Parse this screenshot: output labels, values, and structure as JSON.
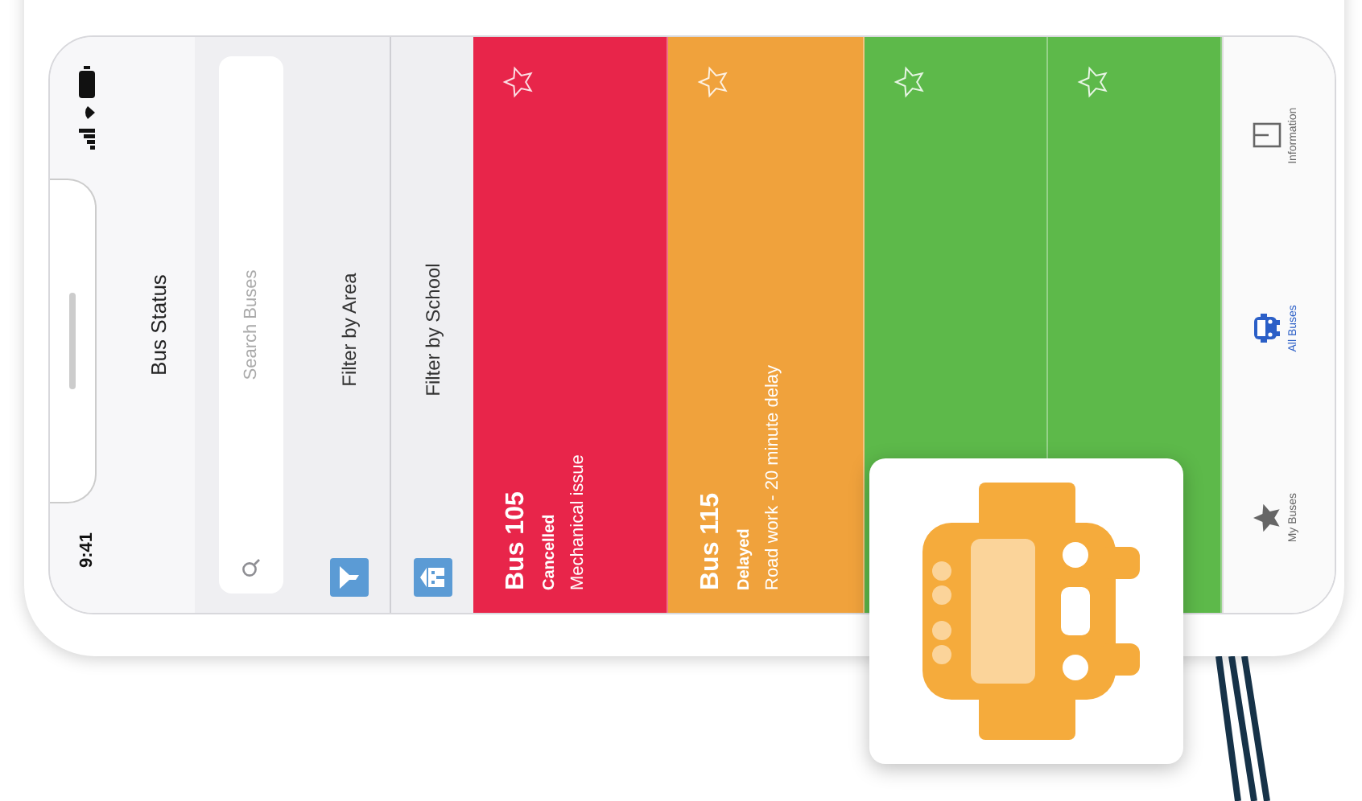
{
  "status_bar": {
    "time": "9:41"
  },
  "nav": {
    "title": "Bus Status"
  },
  "search": {
    "placeholder": "Search Buses"
  },
  "filters": [
    {
      "kind": "area",
      "label": "Filter by Area"
    },
    {
      "kind": "school",
      "label": "Filter by School"
    }
  ],
  "buses": [
    {
      "name": "Bus 105",
      "status": "Cancelled",
      "detail": "Mechanical issue",
      "color": "#e8254a",
      "favorite": false
    },
    {
      "name": "Bus 115",
      "status": "Delayed",
      "detail": "Road work - 20 minute delay",
      "color": "#f0a23c",
      "favorite": false
    },
    {
      "color": "#5db94a",
      "favorite": false
    },
    {
      "color": "#5db94a",
      "favorite": false
    }
  ],
  "tabs": [
    {
      "kind": "star",
      "label": "My Buses",
      "selected": false
    },
    {
      "kind": "bus",
      "label": "All Buses",
      "selected": true
    },
    {
      "kind": "info",
      "label": "Information",
      "selected": false
    }
  ]
}
